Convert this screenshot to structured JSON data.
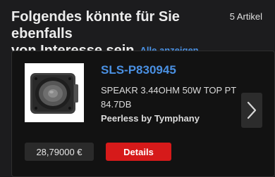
{
  "header": {
    "title_line1": "Folgendes könnte für Sie ebenfalls",
    "title_line2": "von Interesse sein",
    "see_all": "Alle anzeigen",
    "count": "5 Artikel"
  },
  "product": {
    "sku": "SLS-P830945",
    "description": "SPEAKR 3.44OHM 50W TOP PT 84.7DB",
    "brand": "Peerless by Tymphany",
    "price": "28,79000 €",
    "details_label": "Details",
    "image_icon": "speaker-driver"
  },
  "colors": {
    "background": "#1c1c1e",
    "link": "#4a90e2",
    "details_button": "#d61a1a"
  },
  "icons": {
    "next": "chevron-right-icon"
  }
}
